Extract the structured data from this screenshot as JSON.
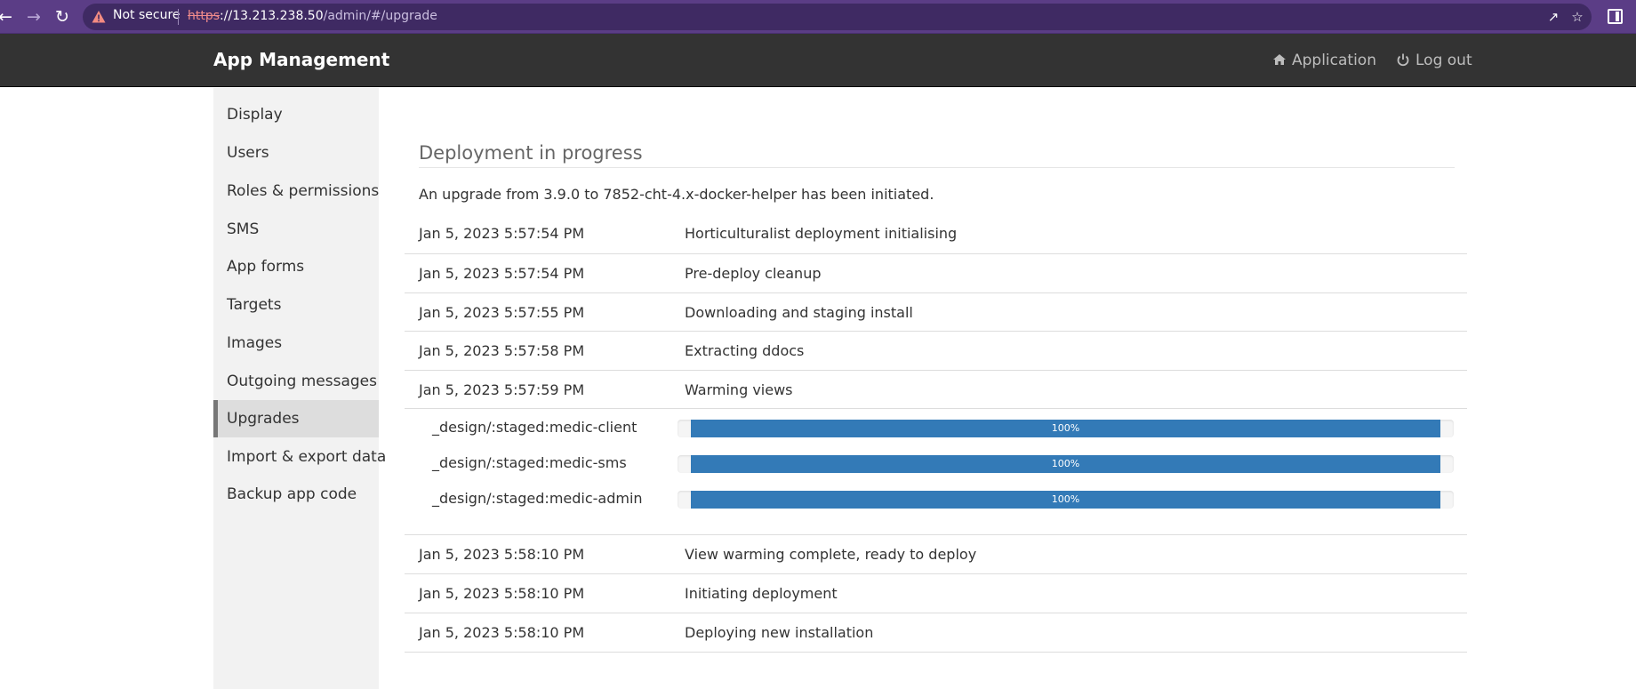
{
  "browser": {
    "back_icon": "back-arrow-icon",
    "forward_icon": "forward-arrow-icon",
    "reload_icon": "reload-icon",
    "security_label": "Not secure",
    "url_scheme": "https",
    "url_host": "://13.213.238.50",
    "url_path": "/admin/#/upgrade",
    "share_icon": "share-icon",
    "bookmark_icon": "star-icon",
    "side_panel_icon": "side-panel-icon",
    "chrome_color": "#5b3d86"
  },
  "navbar": {
    "brand": "App Management",
    "application_label": "Application",
    "logout_label": "Log out",
    "background": "#333333"
  },
  "sidebar": {
    "items": [
      {
        "label": "Display"
      },
      {
        "label": "Users"
      },
      {
        "label": "Roles & permissions"
      },
      {
        "label": "SMS"
      },
      {
        "label": "App forms"
      },
      {
        "label": "Targets"
      },
      {
        "label": "Images"
      },
      {
        "label": "Outgoing messages"
      },
      {
        "label": "Upgrades",
        "active": true
      },
      {
        "label": "Import & export data"
      },
      {
        "label": "Backup app code"
      }
    ]
  },
  "main": {
    "title": "Deployment in progress",
    "intro": "An upgrade from 3.9.0 to 7852-cht-4.x-docker-helper has been initiated.",
    "log_before": [
      {
        "time": "Jan 5, 2023 5:57:54 PM",
        "message": "Horticulturalist deployment initialising"
      },
      {
        "time": "Jan 5, 2023 5:57:54 PM",
        "message": "Pre-deploy cleanup"
      },
      {
        "time": "Jan 5, 2023 5:57:55 PM",
        "message": "Downloading and staging install"
      },
      {
        "time": "Jan 5, 2023 5:57:58 PM",
        "message": "Extracting ddocs"
      },
      {
        "time": "Jan 5, 2023 5:57:59 PM",
        "message": "Warming views"
      }
    ],
    "views": [
      {
        "name": "_design/:staged:medic-client",
        "progress": 100,
        "label": "100%"
      },
      {
        "name": "_design/:staged:medic-sms",
        "progress": 100,
        "label": "100%"
      },
      {
        "name": "_design/:staged:medic-admin",
        "progress": 100,
        "label": "100%"
      }
    ],
    "log_after": [
      {
        "time": "Jan 5, 2023 5:58:10 PM",
        "message": "View warming complete, ready to deploy"
      },
      {
        "time": "Jan 5, 2023 5:58:10 PM",
        "message": "Initiating deployment"
      },
      {
        "time": "Jan 5, 2023 5:58:10 PM",
        "message": "Deploying new installation"
      }
    ],
    "progress_color": "#337ab7"
  }
}
